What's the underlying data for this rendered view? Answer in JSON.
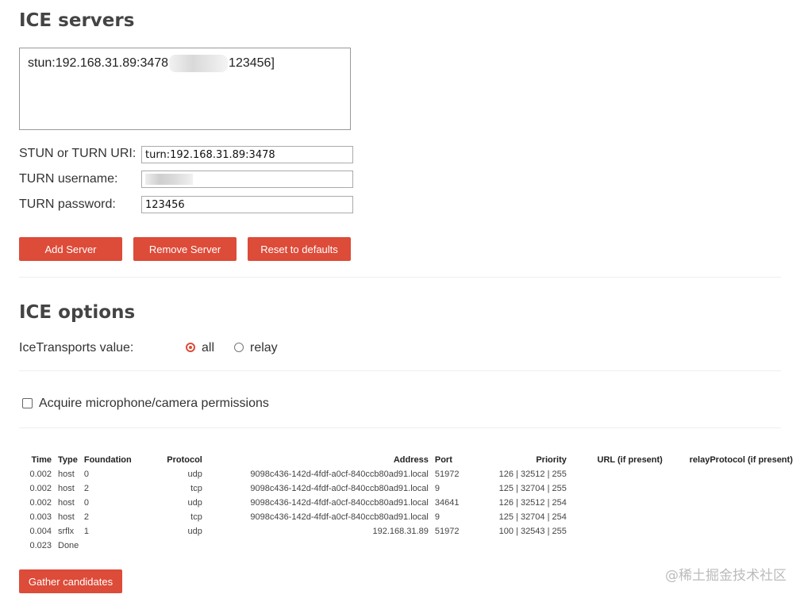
{
  "ice_servers": {
    "title": "ICE servers",
    "entry_prefix": "stun:192.168.31.89:3478",
    "entry_suffix": "123456]",
    "uri_label": "STUN or TURN URI:",
    "uri_value": "turn:192.168.31.89:3478",
    "username_label": "TURN username:",
    "password_label": "TURN password:",
    "password_value": "123456",
    "add_label": "Add Server",
    "remove_label": "Remove Server",
    "reset_label": "Reset to defaults"
  },
  "ice_options": {
    "title": "ICE options",
    "transports_label": "IceTransports value:",
    "option_all": "all",
    "option_relay": "relay",
    "selected": "all",
    "permissions_label": "Acquire microphone/camera permissions",
    "permissions_checked": false
  },
  "candidates": {
    "headers": [
      "Time",
      "Type",
      "Foundation",
      "Protocol",
      "Address",
      "Port",
      "Priority",
      "URL (if present)",
      "relayProtocol (if present)"
    ],
    "rows": [
      {
        "time": "0.002",
        "type": "host",
        "foundation": "0",
        "protocol": "udp",
        "address": "9098c436-142d-4fdf-a0cf-840ccb80ad91.local",
        "port": "51972",
        "priority": "126 | 32512 | 255",
        "url": "",
        "relay": ""
      },
      {
        "time": "0.002",
        "type": "host",
        "foundation": "2",
        "protocol": "tcp",
        "address": "9098c436-142d-4fdf-a0cf-840ccb80ad91.local",
        "port": "9",
        "priority": "125 | 32704 | 255",
        "url": "",
        "relay": ""
      },
      {
        "time": "0.002",
        "type": "host",
        "foundation": "0",
        "protocol": "udp",
        "address": "9098c436-142d-4fdf-a0cf-840ccb80ad91.local",
        "port": "34641",
        "priority": "126 | 32512 | 254",
        "url": "",
        "relay": ""
      },
      {
        "time": "0.003",
        "type": "host",
        "foundation": "2",
        "protocol": "tcp",
        "address": "9098c436-142d-4fdf-a0cf-840ccb80ad91.local",
        "port": "9",
        "priority": "125 | 32704 | 254",
        "url": "",
        "relay": ""
      },
      {
        "time": "0.004",
        "type": "srflx",
        "foundation": "1",
        "protocol": "udp",
        "address": "192.168.31.89",
        "port": "51972",
        "priority": "100 | 32543 | 255",
        "url": "",
        "relay": ""
      }
    ],
    "done_time": "0.023",
    "done_label": "Done",
    "gather_label": "Gather candidates"
  },
  "watermark": "@稀土掘金技术社区",
  "colors": {
    "accent": "#dd4b39",
    "heading": "#444444",
    "divider": "#eeeeee"
  }
}
